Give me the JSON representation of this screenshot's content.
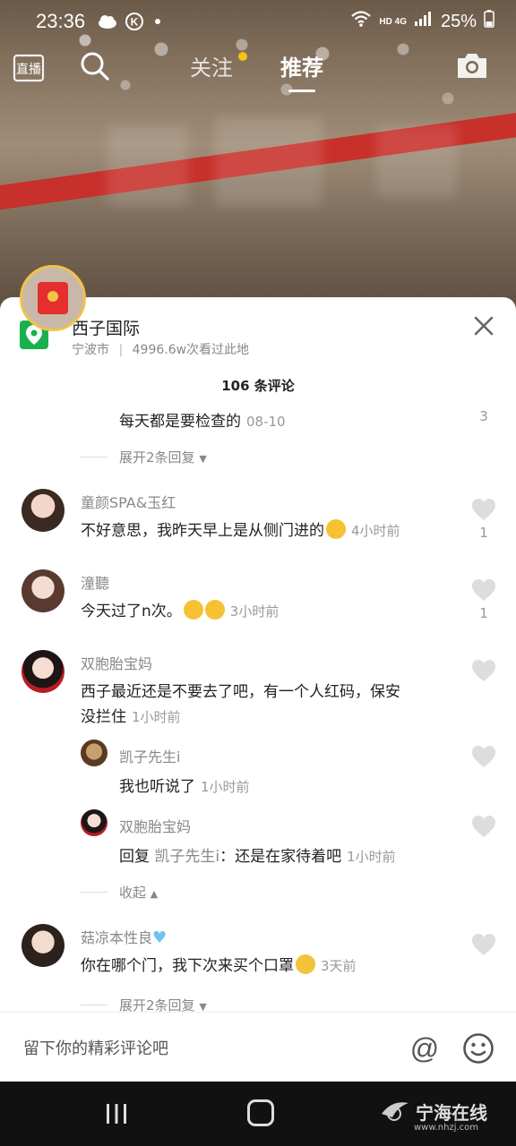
{
  "status_bar": {
    "time": "23:36",
    "network": "HD 4G",
    "battery": "25%"
  },
  "top_nav": {
    "live_label": "直播",
    "follow_tab": "关注",
    "recommend_tab": "推荐"
  },
  "location": {
    "title": "西子国际",
    "city": "宁波市",
    "separator": "|",
    "visits": "4996.6w次看过此地"
  },
  "comments_header": "106 条评论",
  "comments": [
    {
      "type": "reply-tail",
      "text": "每天都是要检查的",
      "time": "08-10",
      "likes": "3",
      "expand": "展开2条回复"
    },
    {
      "name": "童颜SPA&玉红",
      "text": "不好意思，我昨天早上是从侧门进的",
      "time": "4小时前",
      "likes": "1"
    },
    {
      "name": "潼聽",
      "text": "今天过了n次。",
      "time": "3小时前",
      "likes": "1"
    },
    {
      "name": "双胞胎宝妈",
      "text_line1": "西子最近还是不要去了吧，有一个人红码，保安",
      "text_line2": "没拦住",
      "time": "1小时前",
      "replies": [
        {
          "name": "凯子先生i",
          "text": "我也听说了",
          "time": "1小时前"
        },
        {
          "name": "双胞胎宝妈",
          "reply_prefix": "回复",
          "reply_to": "凯子先生i",
          "text": "：还是在家待着吧",
          "time": "1小时前"
        }
      ],
      "collapse": "收起"
    },
    {
      "name": "菇凉本性良",
      "text": "你在哪个门，我下次来买个口罩",
      "time": "3天前",
      "expand": "展开2条回复"
    }
  ],
  "input": {
    "placeholder": "留下你的精彩评论吧",
    "at_symbol": "@"
  },
  "watermark": {
    "text": "宁海在线",
    "url": "www.nhzj.com"
  },
  "colors": {
    "accent_dot": "#f5c317",
    "location_green": "#19b14f",
    "red_packet": "#e52e2e"
  }
}
